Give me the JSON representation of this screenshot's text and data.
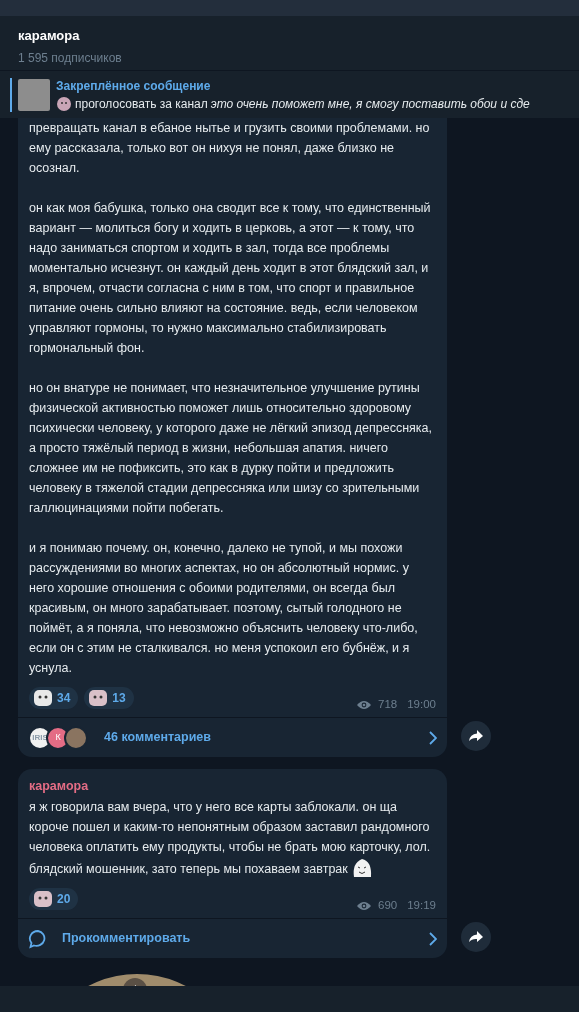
{
  "header": {
    "title": "карамора",
    "subtitle": "1 595 подписчиков"
  },
  "pinned": {
    "title": "Закреплённое сообщение",
    "text": "проголосовать за канал",
    "italic_text": "это очень поможет мне, я смогу поставить обои и сде"
  },
  "messages": [
    {
      "kind": "post",
      "paragraphs": [
        "превращать канал в ебаное нытье и грузить своими проблемами. но ему рассказала, только вот он нихуя не понял, даже близко не осознал.",
        "он как моя бабушка, только она сводит все к тому, что единственный вариант — молиться богу и ходить в церковь, а этот — к тому, что надо заниматься спортом и ходить в зал, тогда все проблемы моментально исчезнут. он каждый день ходит в этот блядский зал, и я, впрочем, отчасти согласна с ним в том, что спорт и правильное питание очень сильно влияют на состояние. ведь, если человеком управляют гормоны, то нужно максимально стабилизировать гормональный фон.",
        "но он внатуре не понимает, что незначительное улучшение рутины физической активностью поможет лишь относительно здоровому психически человеку, у которого даже не лёгкий эпизод депрессняка, а просто тяжёлый период в жизни, небольшая апатия. ничего сложнее им не пофиксить, это как в дурку пойти и предложить человеку в тяжелой стадии депрессняка или шизу со зрительными галлюцинациями пойти побегать.",
        "и я понимаю почему. он, конечно, далеко не тупой, и мы похожи рассуждениями во многих аспектах, но он абсолютный нормис. у него хорошие отношения с обоими родителями, он всегда был красивым, он много зарабатывает. поэтому, сытый голодного не поймёт, а я поняла, что невозможно объяснить человеку что-либо, если он с этим не сталкивался. но меня успокоил его бубнёж, и я уснула."
      ],
      "trailing_sticker": false,
      "reactions": [
        "34",
        "13"
      ],
      "views": "718",
      "time": "19:00",
      "comments": {
        "kind": "count",
        "label": "46 комментариев",
        "avatars": [
          {
            "kind": "logo",
            "text": "IRIS"
          },
          {
            "kind": "letter",
            "text": "К"
          },
          {
            "kind": "photo"
          }
        ]
      }
    },
    {
      "kind": "post",
      "author": "карамора",
      "paragraphs": [
        "я ж говорила вам вчера, что у него все карты заблокали. он ща короче пошел и каким-то непонятным образом заставил рандомного человека оплатить ему продукты, чтобы не брать мою карточку, лол. блядский мошенник, зато теперь мы похаваем завтрак"
      ],
      "trailing_sticker": true,
      "reactions": [
        "20"
      ],
      "views": "690",
      "time": "19:19",
      "comments": {
        "kind": "prompt",
        "label": "Прокомментировать"
      }
    }
  ]
}
